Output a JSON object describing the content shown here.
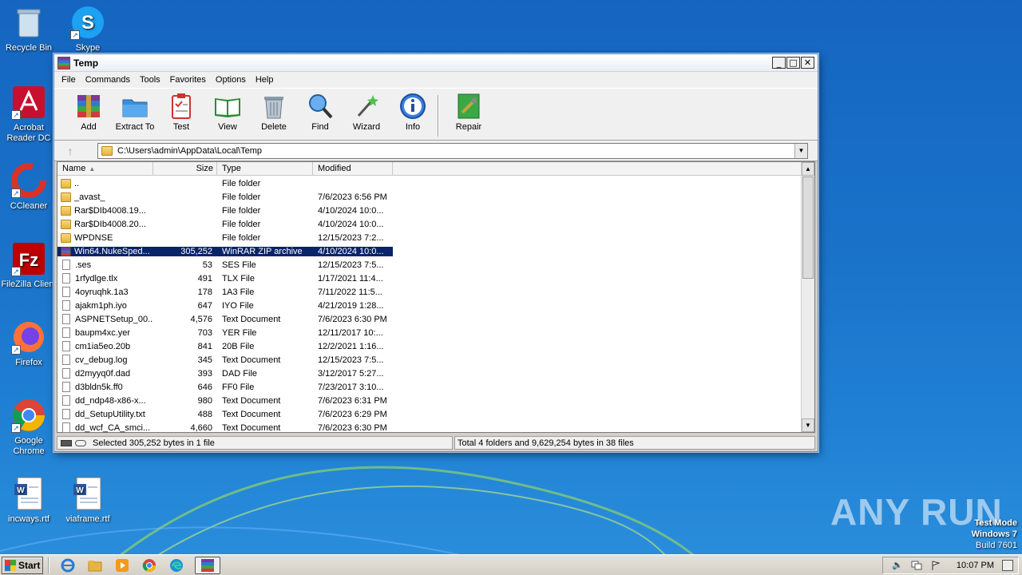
{
  "desktop": {
    "icons": [
      {
        "label": "Recycle Bin",
        "icon": "recycle-bin-icon"
      },
      {
        "label": "Skype",
        "icon": "skype-icon"
      },
      {
        "label": "Acrobat Reader DC",
        "icon": "acrobat-icon"
      },
      {
        "label": "CCleaner",
        "icon": "ccleaner-icon"
      },
      {
        "label": "FileZilla Client",
        "icon": "filezilla-icon"
      },
      {
        "label": "Firefox",
        "icon": "firefox-icon"
      },
      {
        "label": "Google Chrome",
        "icon": "chrome-icon"
      },
      {
        "label": "incways.rtf",
        "icon": "word-document-icon"
      },
      {
        "label": "viaframe.rtf",
        "icon": "word-document-icon"
      }
    ]
  },
  "window": {
    "title": "Temp",
    "buttons": {
      "minimize": "_",
      "maximize": "□",
      "close": "✕"
    },
    "menu": [
      "File",
      "Commands",
      "Tools",
      "Favorites",
      "Options",
      "Help"
    ],
    "toolbar": [
      "Add",
      "Extract To",
      "Test",
      "View",
      "Delete",
      "Find",
      "Wizard",
      "Info",
      "Repair"
    ],
    "address": "C:\\Users\\admin\\AppData\\Local\\Temp",
    "columns": {
      "name": "Name",
      "size": "Size",
      "type": "Type",
      "modified": "Modified"
    },
    "files": [
      {
        "name": "..",
        "size": "",
        "type": "File folder",
        "modified": "",
        "kind": "folder"
      },
      {
        "name": "_avast_",
        "size": "",
        "type": "File folder",
        "modified": "7/6/2023 6:56 PM",
        "kind": "folder"
      },
      {
        "name": "Rar$DIb4008.19...",
        "size": "",
        "type": "File folder",
        "modified": "4/10/2024 10:0...",
        "kind": "folder"
      },
      {
        "name": "Rar$DIb4008.20...",
        "size": "",
        "type": "File folder",
        "modified": "4/10/2024 10:0...",
        "kind": "folder"
      },
      {
        "name": "WPDNSE",
        "size": "",
        "type": "File folder",
        "modified": "12/15/2023 7:2...",
        "kind": "folder"
      },
      {
        "name": "Win64.NukeSped...",
        "size": "305,252",
        "type": "WinRAR ZIP archive",
        "modified": "4/10/2024 10:0...",
        "kind": "zip",
        "selected": true
      },
      {
        "name": ".ses",
        "size": "53",
        "type": "SES File",
        "modified": "12/15/2023 7:5...",
        "kind": "doc"
      },
      {
        "name": "1rfydlge.tlx",
        "size": "491",
        "type": "TLX File",
        "modified": "1/17/2021 11:4...",
        "kind": "doc"
      },
      {
        "name": "4oyruqhk.1a3",
        "size": "178",
        "type": "1A3 File",
        "modified": "7/11/2022 11:5...",
        "kind": "doc"
      },
      {
        "name": "ajakm1ph.iyo",
        "size": "647",
        "type": "IYO File",
        "modified": "4/21/2019 1:28...",
        "kind": "doc"
      },
      {
        "name": "ASPNETSetup_00...",
        "size": "4,576",
        "type": "Text Document",
        "modified": "7/6/2023 6:30 PM",
        "kind": "doc"
      },
      {
        "name": "baupm4xc.yer",
        "size": "703",
        "type": "YER File",
        "modified": "12/11/2017 10:...",
        "kind": "doc"
      },
      {
        "name": "cm1ia5eo.20b",
        "size": "841",
        "type": "20B File",
        "modified": "12/2/2021 1:16...",
        "kind": "doc"
      },
      {
        "name": "cv_debug.log",
        "size": "345",
        "type": "Text Document",
        "modified": "12/15/2023 7:5...",
        "kind": "doc"
      },
      {
        "name": "d2myyq0f.dad",
        "size": "393",
        "type": "DAD File",
        "modified": "3/12/2017 5:27...",
        "kind": "doc"
      },
      {
        "name": "d3bldn5k.ff0",
        "size": "646",
        "type": "FF0 File",
        "modified": "7/23/2017 3:10...",
        "kind": "doc"
      },
      {
        "name": "dd_ndp48-x86-x...",
        "size": "980",
        "type": "Text Document",
        "modified": "7/6/2023 6:31 PM",
        "kind": "doc"
      },
      {
        "name": "dd_SetupUtility.txt",
        "size": "488",
        "type": "Text Document",
        "modified": "7/6/2023 6:29 PM",
        "kind": "doc"
      },
      {
        "name": "dd_wcf_CA_smci...",
        "size": "4,660",
        "type": "Text Document",
        "modified": "7/6/2023 6:30 PM",
        "kind": "doc"
      }
    ],
    "status_left": "Selected 305,252 bytes in 1 file",
    "status_right": "Total 4 folders and 9,629,254 bytes in 38 files"
  },
  "watermark": "ANY RUN",
  "testmode": {
    "line1": "Test Mode",
    "line2": "Windows 7",
    "line3": "Build 7601"
  },
  "taskbar": {
    "start": "Start",
    "apps": [
      "internet-explorer-icon",
      "explorer-icon",
      "media-player-icon",
      "chrome-icon",
      "edge-icon",
      "winrar-icon"
    ],
    "clock": "10:07 PM"
  }
}
